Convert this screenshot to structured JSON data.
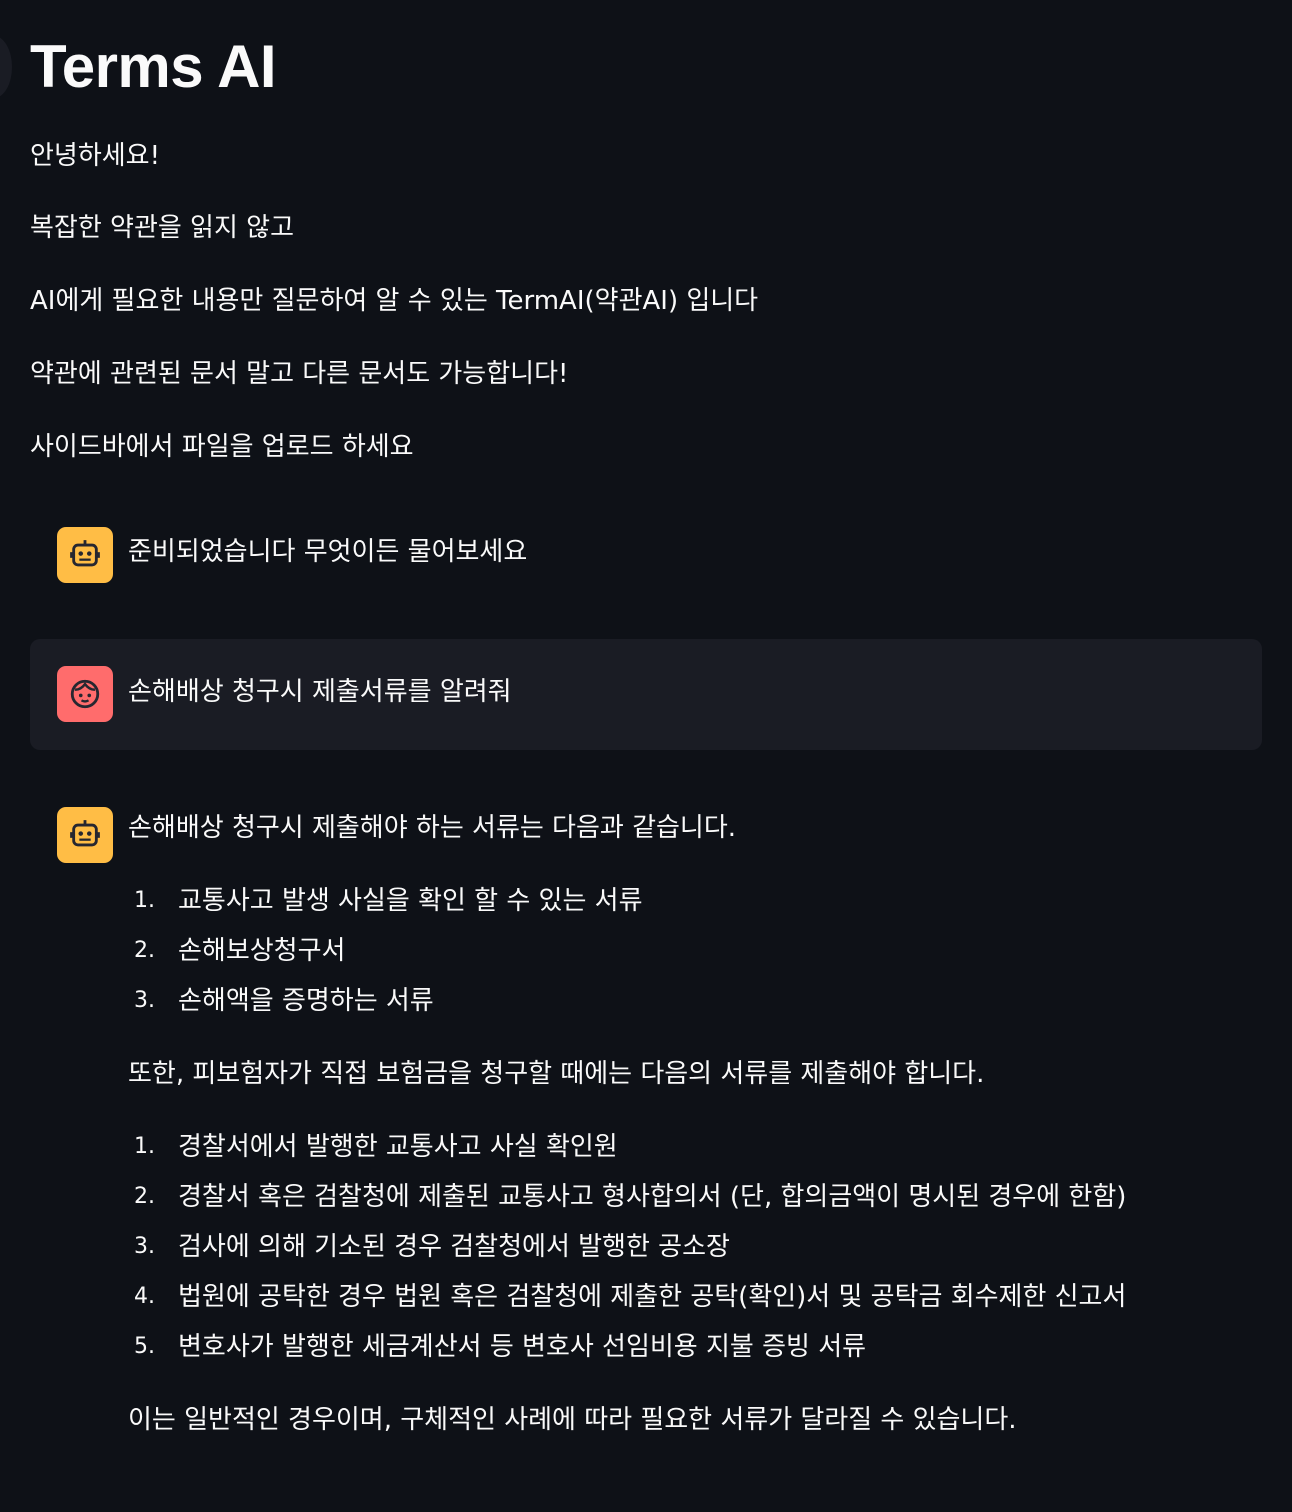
{
  "app": {
    "title": "Terms AI"
  },
  "intro": [
    "안녕하세요!",
    "복잡한 약관을 읽지 않고",
    "AI에게 필요한 내용만 질문하여 알 수 있는 TermAI(약관AI) 입니다",
    "약관에 관련된 문서 말고 다른 문서도 가능합니다!",
    "사이드바에서 파일을 업로드 하세요"
  ],
  "chat": {
    "bot_greeting": "준비되었습니다 무엇이든 물어보세요",
    "user_question": "손해배상 청구시 제출서류를 알려줘",
    "answer_intro": "손해배상 청구시 제출해야 하는 서류는 다음과 같습니다.",
    "list1": [
      {
        "num": "1.",
        "text": "교통사고 발생 사실을 확인 할 수 있는 서류"
      },
      {
        "num": "2.",
        "text": "손해보상청구서"
      },
      {
        "num": "3.",
        "text": "손해액을 증명하는 서류"
      }
    ],
    "answer_middle": "또한, 피보험자가 직접 보험금을 청구할 때에는 다음의 서류를 제출해야 합니다.",
    "list2": [
      {
        "num": "1.",
        "text": "경찰서에서 발행한 교통사고 사실 확인원"
      },
      {
        "num": "2.",
        "text": "경찰서 혹은 검찰청에 제출된 교통사고 형사합의서 (단, 합의금액이 명시된 경우에 한함)"
      },
      {
        "num": "3.",
        "text": "검사에 의해 기소된 경우 검찰청에서 발행한 공소장"
      },
      {
        "num": "4.",
        "text": "법원에 공탁한 경우 법원 혹은 검찰청에 제출한 공탁(확인)서 및 공탁금 회수제한 신고서"
      },
      {
        "num": "5.",
        "text": "변호사가 발행한 세금계산서 등 변호사 선임비용 지불 증빙 서류"
      }
    ],
    "answer_outro": "이는 일반적인 경우이며, 구체적인 사례에 따라 필요한 서류가 달라질 수 있습니다."
  },
  "icons": {
    "bot_avatar": "robot-icon",
    "user_avatar": "face-icon"
  },
  "colors": {
    "background": "#0e1117",
    "bot_avatar": "#ffbd45",
    "user_avatar": "#ff6c6c",
    "user_bubble": "#1a1c24",
    "text": "#fafafa"
  }
}
